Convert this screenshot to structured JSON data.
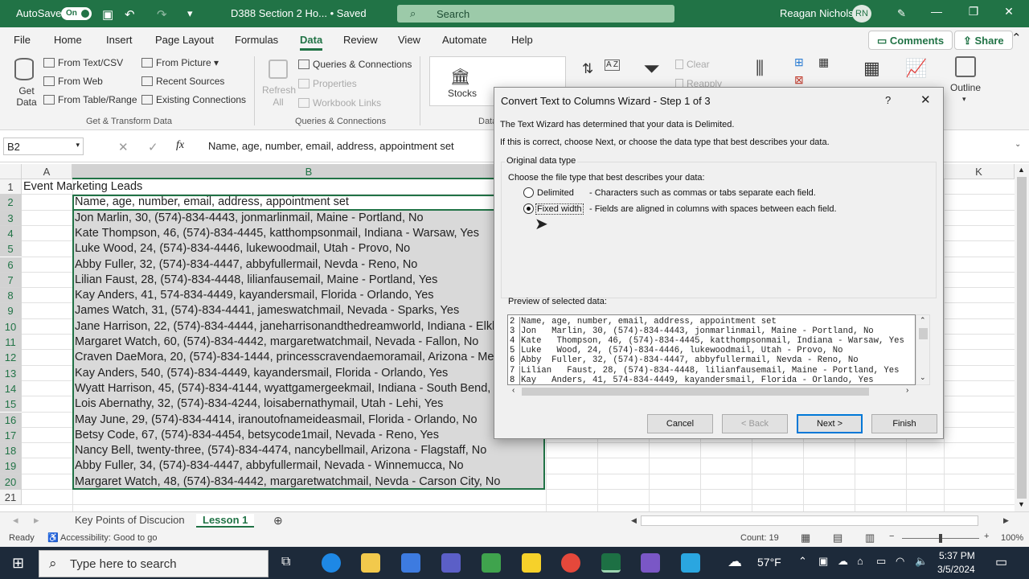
{
  "titlebar": {
    "autosave_label": "AutoSave",
    "autosave_state": "On",
    "doc_title": "D388 Section 2 Ho... • Saved",
    "search_placeholder": "Search",
    "user_name": "Reagan Nichols",
    "user_initials": "RN"
  },
  "menu": {
    "items": [
      "File",
      "Home",
      "Insert",
      "Page Layout",
      "Formulas",
      "Data",
      "Review",
      "View",
      "Automate",
      "Help"
    ],
    "active": "Data",
    "comments": "Comments",
    "share": "Share"
  },
  "ribbon": {
    "get_data": "Get Data",
    "get_items": [
      "From Text/CSV",
      "From Web",
      "From Table/Range",
      "From Picture",
      "Recent Sources",
      "Existing Connections"
    ],
    "get_group": "Get & Transform Data",
    "refresh": "Refresh All",
    "query_items": [
      "Queries & Connections",
      "Properties",
      "Workbook Links"
    ],
    "query_group": "Queries & Connections",
    "stocks": "Stocks",
    "data_group_partial": "Data",
    "clear": "Clear",
    "reapply": "Reapply",
    "outline": "Outline"
  },
  "formula_bar": {
    "name_box": "B2",
    "fx": "fx",
    "formula": "Name, age, number, email, address, appointment set"
  },
  "sheet": {
    "columns": [
      "A",
      "B",
      "K"
    ],
    "row_numbers": [
      "1",
      "2",
      "3",
      "4",
      "5",
      "6",
      "7",
      "8",
      "9",
      "10",
      "11",
      "12",
      "13",
      "14",
      "15",
      "16",
      "17",
      "18",
      "19",
      "20",
      "21"
    ],
    "a1": "Event Marketing Leads",
    "cells_b": [
      "Name, age, number, email, address, appointment set",
      "Jon   Marlin, 30, (574)-834-4443, jonmarlinmail, Maine - Portland, No",
      "Kate   Thompson, 46, (574)-834-4445, katthompsonmail, Indiana - Warsaw, Yes",
      "Luke   Wood, 24, (574)-834-4446, lukewoodmail, Utah - Provo, No",
      "Abby  Fuller, 32, (574)-834-4447, abbyfullermail, Nevda - Reno, No",
      "Lilian   Faust, 28, (574)-834-4448, lilianfausemail, Maine - Portland, Yes",
      "Kay   Anders, 41, 574-834-4449, kayandersmail, Florida - Orlando, Yes",
      "James   Watch, 31, (574)-834-4441, jameswatchmail, Nevada - Sparks, Yes",
      "Jane   Harrison, 22, (574)-834-4444, janeharrisonandthedreamworld, Indiana - Elkh",
      "Margaret   Watch, 60, (574)-834-4442, margaretwatchmail, Nevada - Fallon, No",
      "Craven   DaeMora, 20, (574)-834-1444, princesscravendaemoramail, Arizona - Me",
      "Kay   Anders, 540, (574)-834-4449, kayandersmail, Florida - Orlando, Yes",
      "Wyatt   Harrison, 45, (574)-834-4144, wyattgamergeekmail, Indiana - South Bend,",
      "Lois   Abernathy, 32, (574)-834-4244, loisabernathymail, Utah - Lehi, Yes",
      "May   June, 29, (574)-834-4414, iranoutofnameideasmail, Florida - Orlando, No",
      "Betsy   Code, 67, (574)-834-4454, betsycode1mail, Nevada - Reno, Yes",
      "Nancy   Bell, twenty-three, (574)-834-4474, nancybellmail, Arizona - Flagstaff, No",
      "Abby   Fuller, 34, (574)-834-4447, abbyfullermail, Nevada - Winnemucca, No",
      "Margaret   Watch, 48, (574)-834-4442, margaretwatchmail, Nevda - Carson City, No"
    ]
  },
  "tabs": {
    "items": [
      "Key Points of Discucion",
      "Lesson 1"
    ],
    "active": "Lesson 1"
  },
  "status": {
    "ready": "Ready",
    "accessibility": "Accessibility: Good to go",
    "count": "Count: 19",
    "zoom": "100%"
  },
  "taskbar": {
    "search_placeholder": "Type here to search",
    "weather": "57°F",
    "time": "5:37 PM",
    "date": "3/5/2024"
  },
  "dialog": {
    "title": "Convert Text to Columns Wizard - Step 1 of 3",
    "help": "?",
    "line1": "The Text Wizard has determined that your data is Delimited.",
    "line2": "If this is correct, choose Next, or choose the data type that best describes your data.",
    "section": "Original data type",
    "choose": "Choose the file type that best describes your data:",
    "opt1_label": "Delimited",
    "opt1_desc": "- Characters such as commas or tabs separate each field.",
    "opt2_label": "Fixed width",
    "opt2_desc": "- Fields are aligned in columns with spaces between each field.",
    "selected": "Fixed width",
    "preview_label": "Preview of selected data:",
    "preview_rows": [
      {
        "n": "2",
        "t": "Name, age, number, email, address, appointment set"
      },
      {
        "n": "3",
        "t": "Jon   Marlin, 30, (574)-834-4443, jonmarlinmail, Maine - Portland, No"
      },
      {
        "n": "4",
        "t": "Kate   Thompson, 46, (574)-834-4445, katthompsonmail, Indiana - Warsaw, Yes"
      },
      {
        "n": "5",
        "t": "Luke   Wood, 24, (574)-834-4446, lukewoodmail, Utah - Provo, No"
      },
      {
        "n": "6",
        "t": "Abby  Fuller, 32, (574)-834-4447, abbyfullermail, Nevda - Reno, No"
      },
      {
        "n": "7",
        "t": "Lilian   Faust, 28, (574)-834-4448, lilianfausemail, Maine - Portland, Yes"
      },
      {
        "n": "8",
        "t": "Kay   Anders, 41, 574-834-4449, kayandersmail, Florida - Orlando, Yes"
      }
    ],
    "buttons": {
      "cancel": "Cancel",
      "back": "< Back",
      "next": "Next >",
      "finish": "Finish"
    }
  }
}
